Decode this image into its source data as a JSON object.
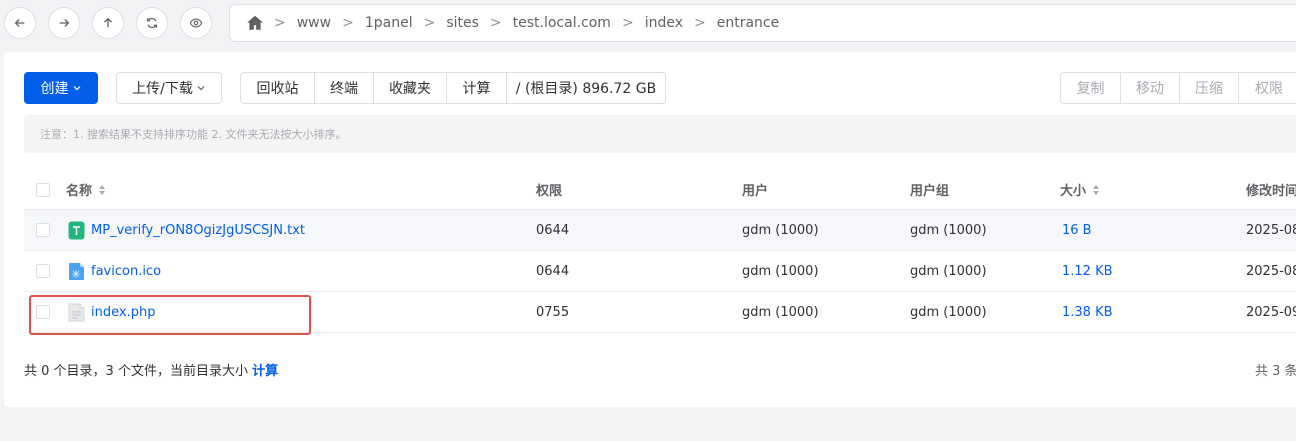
{
  "nav": {
    "buttons": [
      "back-icon",
      "forward-icon",
      "up-icon",
      "refresh-icon",
      "eye-icon"
    ],
    "breadcrumb": [
      "www",
      "1panel",
      "sites",
      "test.local.com",
      "index",
      "entrance"
    ],
    "separator": ">"
  },
  "toolbar": {
    "create_label": "创建",
    "upload_label": "上传/下载",
    "group1": [
      "回收站",
      "终端",
      "收藏夹",
      "计算"
    ],
    "disk_info": "/ (根目录) 896.72 GB",
    "group2": [
      "复制",
      "移动",
      "压缩",
      "权限"
    ]
  },
  "notice": "注意：1. 搜索结果不支持排序功能 2. 文件夹无法按大小排序。",
  "table": {
    "headers": {
      "name": "名称",
      "perm": "权限",
      "user": "用户",
      "group": "用户组",
      "size": "大小",
      "mtime": "修改时间"
    },
    "rows": [
      {
        "name": "MP_verify_rON8OgizJgUSCSJN.txt",
        "perm": "0644",
        "user": "gdm (1000)",
        "group": "gdm (1000)",
        "size": "16 B",
        "mtime": "2025-08",
        "icon": "txt-file-icon"
      },
      {
        "name": "favicon.ico",
        "perm": "0644",
        "user": "gdm (1000)",
        "group": "gdm (1000)",
        "size": "1.12 KB",
        "mtime": "2025-08",
        "icon": "image-file-icon"
      },
      {
        "name": "index.php",
        "perm": "0755",
        "user": "gdm (1000)",
        "group": "gdm (1000)",
        "size": "1.38 KB",
        "mtime": "2025-09",
        "icon": "generic-file-icon"
      }
    ]
  },
  "footer": {
    "summary": "共 0 个目录，3 个文件，当前目录大小",
    "calc_link": "计算",
    "total": "共 3 条"
  },
  "colors": {
    "primary": "#005eeb",
    "highlight": "#d9534f"
  }
}
